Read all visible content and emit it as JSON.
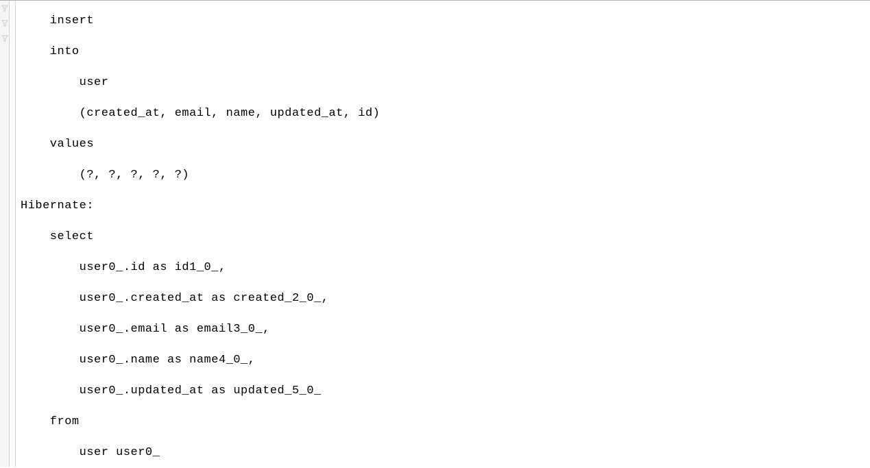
{
  "console": {
    "lines": [
      "    insert ",
      "    into",
      "        user",
      "        (created_at, email, name, updated_at, id) ",
      "    values",
      "        (?, ?, ?, ?, ?)",
      "Hibernate: ",
      "    select",
      "        user0_.id as id1_0_,",
      "        user0_.created_at as created_2_0_,",
      "        user0_.email as email3_0_,",
      "        user0_.name as name4_0_,",
      "        user0_.updated_at as updated_5_0_ ",
      "    from",
      "        user user0_ "
    ]
  },
  "gutter": {
    "icons": [
      "s",
      "s",
      "s"
    ]
  }
}
